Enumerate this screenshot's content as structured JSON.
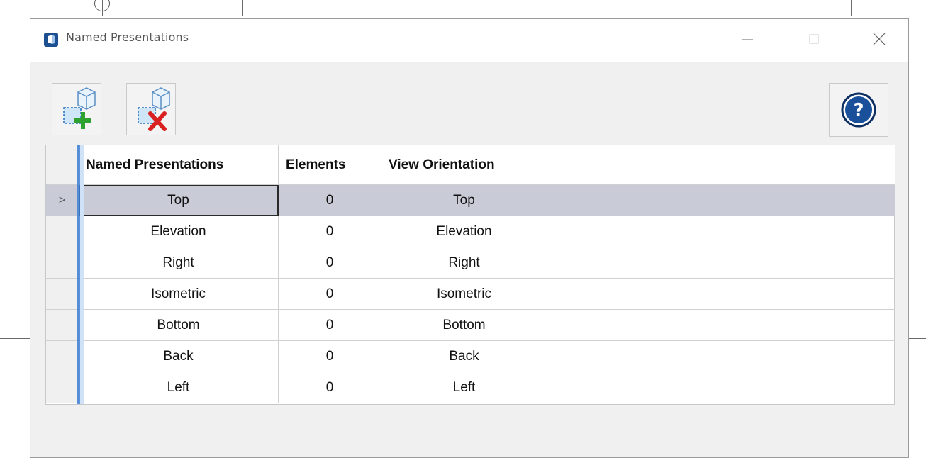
{
  "window": {
    "title": "Named Presentations"
  },
  "titlebar": {
    "minimize_icon": "minimize-icon",
    "maximize_icon": "maximize-icon",
    "close_icon": "close-icon"
  },
  "toolbar": {
    "add_icon": "add-presentation-icon",
    "delete_icon": "delete-presentation-icon",
    "help_icon": "help-icon"
  },
  "grid": {
    "columns": [
      "Named Presentations",
      "Elements",
      "View Orientation"
    ],
    "rows": [
      {
        "name": "Top",
        "elements": "0",
        "orientation": "Top",
        "selected": true
      },
      {
        "name": "Elevation",
        "elements": "0",
        "orientation": "Elevation"
      },
      {
        "name": "Right",
        "elements": "0",
        "orientation": "Right"
      },
      {
        "name": "Isometric",
        "elements": "0",
        "orientation": "Isometric"
      },
      {
        "name": "Bottom",
        "elements": "0",
        "orientation": "Bottom"
      },
      {
        "name": "Back",
        "elements": "0",
        "orientation": "Back"
      },
      {
        "name": "Left",
        "elements": "0",
        "orientation": "Left"
      }
    ],
    "current_row_marker": ">"
  },
  "colors": {
    "selection": "#c9cbd6",
    "accent": "#3d7fd6",
    "help_blue": "#1a4f9a"
  }
}
